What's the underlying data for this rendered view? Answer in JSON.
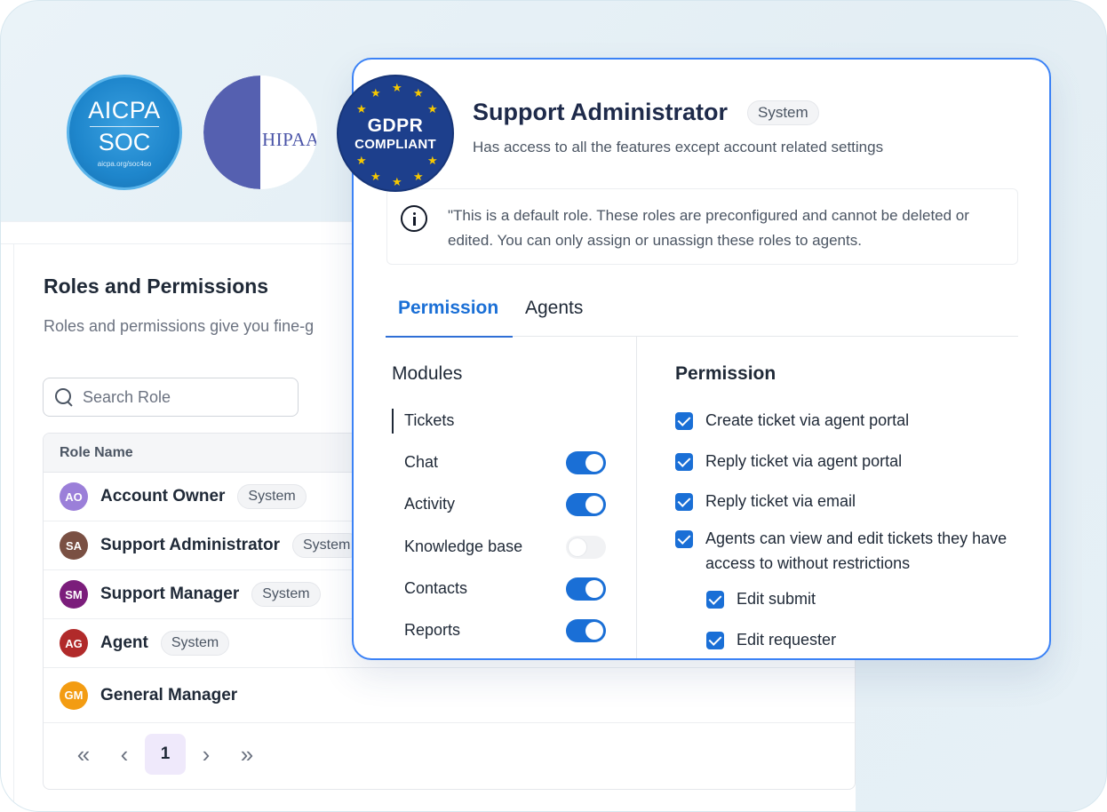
{
  "certifications": {
    "aicpa": {
      "line1": "AICPA",
      "line2": "SOC",
      "small": "aicpa.org/soc4so"
    },
    "hipaa": {
      "label": "HIPAA"
    },
    "gdpr": {
      "line1": "GDPR",
      "line2": "COMPLIANT"
    }
  },
  "roles_page": {
    "title": "Roles and Permissions",
    "subtitle": "Roles and permissions give you fine-g",
    "search": {
      "placeholder": "Search Role",
      "value": ""
    },
    "table": {
      "header": "Role Name",
      "rows": [
        {
          "initials": "AO",
          "name": "Account Owner",
          "badge": "System",
          "avatar_color": "#9b7fd9"
        },
        {
          "initials": "SA",
          "name": "Support Administrator",
          "badge": "System",
          "avatar_color": "#7a5043"
        },
        {
          "initials": "SM",
          "name": "Support Manager",
          "badge": "System",
          "avatar_color": "#7b1d7b"
        },
        {
          "initials": "AG",
          "name": "Agent",
          "badge": "System",
          "avatar_color": "#b12a2a"
        },
        {
          "initials": "GM",
          "name": "General Manager",
          "badge": "",
          "avatar_color": "#f39c12"
        }
      ]
    },
    "pagination": {
      "first": "«",
      "prev": "‹",
      "current": "1",
      "next": "›",
      "last": "»"
    }
  },
  "modal": {
    "title": "Support Administrator",
    "badge": "System",
    "description": "Has access to all the features except account related settings",
    "notice": "\"This is a default role. These roles are preconfigured and cannot be deleted or edited. You can only assign or unassign these roles to agents.",
    "tabs": [
      {
        "label": "Permission",
        "active": true
      },
      {
        "label": "Agents",
        "active": false
      }
    ],
    "modules_title": "Modules",
    "modules": [
      {
        "label": "Tickets",
        "selected": true,
        "toggle": null
      },
      {
        "label": "Chat",
        "toggle": true
      },
      {
        "label": "Activity",
        "toggle": true
      },
      {
        "label": "Knowledge base",
        "toggle": false
      },
      {
        "label": "Contacts",
        "toggle": true
      },
      {
        "label": "Reports",
        "toggle": true
      }
    ],
    "permissions_title": "Permission",
    "permissions": [
      {
        "label": "Create ticket via agent portal",
        "checked": true
      },
      {
        "label": "Reply ticket via agent portal",
        "checked": true
      },
      {
        "label": "Reply ticket via email",
        "checked": true
      },
      {
        "label": "Agents can view and edit tickets they have access to without restrictions",
        "checked": true
      },
      {
        "label": "Edit submit",
        "checked": true
      },
      {
        "label": "Edit requester",
        "checked": true
      }
    ]
  },
  "colors": {
    "accent": "#1a6fd6",
    "modal_border": "#3b82f6",
    "gdpr_blue": "#1d3f8c",
    "aicpa_blue": "#1e86cc",
    "hipaa_blue": "#5560b0"
  }
}
